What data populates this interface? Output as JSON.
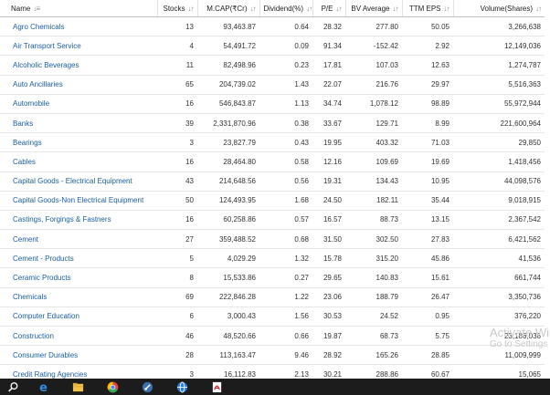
{
  "table": {
    "headers": {
      "name": "Name",
      "stocks": "Stocks",
      "mcap": "M.CAP(₹Cr)",
      "dividend": "Dividend(%)",
      "pe": "P/E",
      "bv": "BV Average",
      "eps": "TTM EPS",
      "volume": "Volume(Shares)"
    },
    "sort_glyph_name": "↓≡",
    "sort_glyph": "↓↑",
    "rows": [
      {
        "name": "Agro Chemicals",
        "stocks": "13",
        "mcap": "93,463.87",
        "dividend": "0.64",
        "pe": "28.32",
        "bv": "277.80",
        "eps": "50.05",
        "volume": "3,266,638"
      },
      {
        "name": "Air Transport Service",
        "stocks": "4",
        "mcap": "54,491.72",
        "dividend": "0.09",
        "pe": "91.34",
        "bv": "-152.42",
        "eps": "2.92",
        "volume": "12,149,036"
      },
      {
        "name": "Alcoholic Beverages",
        "stocks": "11",
        "mcap": "82,498.96",
        "dividend": "0.23",
        "pe": "17.81",
        "bv": "107.03",
        "eps": "12.63",
        "volume": "1,274,787"
      },
      {
        "name": "Auto Ancillaries",
        "stocks": "65",
        "mcap": "204,739.02",
        "dividend": "1.43",
        "pe": "22.07",
        "bv": "216.76",
        "eps": "29.97",
        "volume": "5,516,363"
      },
      {
        "name": "Automobile",
        "stocks": "16",
        "mcap": "546,843.87",
        "dividend": "1.13",
        "pe": "34.74",
        "bv": "1,078.12",
        "eps": "98.89",
        "volume": "55,972,944"
      },
      {
        "name": "Banks",
        "stocks": "39",
        "mcap": "2,331,870.96",
        "dividend": "0.38",
        "pe": "33.67",
        "bv": "129.71",
        "eps": "8.99",
        "volume": "221,600,964"
      },
      {
        "name": "Bearings",
        "stocks": "3",
        "mcap": "23,827.79",
        "dividend": "0.43",
        "pe": "19.95",
        "bv": "403.32",
        "eps": "71.03",
        "volume": "29,850"
      },
      {
        "name": "Cables",
        "stocks": "16",
        "mcap": "28,464.80",
        "dividend": "0.58",
        "pe": "12.16",
        "bv": "109.69",
        "eps": "19.69",
        "volume": "1,418,456"
      },
      {
        "name": "Capital Goods - Electrical Equipment",
        "stocks": "43",
        "mcap": "214,648.56",
        "dividend": "0.56",
        "pe": "19.31",
        "bv": "134.43",
        "eps": "10.95",
        "volume": "44,098,576"
      },
      {
        "name": "Capital Goods-Non Electrical Equipment",
        "stocks": "50",
        "mcap": "124,493.95",
        "dividend": "1.68",
        "pe": "24.50",
        "bv": "182.11",
        "eps": "35.44",
        "volume": "9,018,915"
      },
      {
        "name": "Castings, Forgings & Fastners",
        "stocks": "16",
        "mcap": "60,258.86",
        "dividend": "0.57",
        "pe": "16.57",
        "bv": "88.73",
        "eps": "13.15",
        "volume": "2,367,542"
      },
      {
        "name": "Cement",
        "stocks": "27",
        "mcap": "359,488.52",
        "dividend": "0.68",
        "pe": "31.50",
        "bv": "302.50",
        "eps": "27.83",
        "volume": "6,421,562"
      },
      {
        "name": "Cement - Products",
        "stocks": "5",
        "mcap": "4,029.29",
        "dividend": "1.32",
        "pe": "15.78",
        "bv": "315.20",
        "eps": "45.86",
        "volume": "41,536"
      },
      {
        "name": "Ceramic Products",
        "stocks": "8",
        "mcap": "15,533.86",
        "dividend": "0.27",
        "pe": "29.65",
        "bv": "140.83",
        "eps": "15.61",
        "volume": "661,744"
      },
      {
        "name": "Chemicals",
        "stocks": "69",
        "mcap": "222,846.28",
        "dividend": "1.22",
        "pe": "23.06",
        "bv": "188.79",
        "eps": "26.47",
        "volume": "3,350,736"
      },
      {
        "name": "Computer Education",
        "stocks": "6",
        "mcap": "3,000.43",
        "dividend": "1.56",
        "pe": "30.53",
        "bv": "24.52",
        "eps": "0.95",
        "volume": "376,220"
      },
      {
        "name": "Construction",
        "stocks": "46",
        "mcap": "48,520.66",
        "dividend": "0.66",
        "pe": "19.87",
        "bv": "68.73",
        "eps": "5.75",
        "volume": "23,186,036"
      },
      {
        "name": "Consumer Durables",
        "stocks": "28",
        "mcap": "113,163.47",
        "dividend": "9.46",
        "pe": "28.92",
        "bv": "165.26",
        "eps": "28.85",
        "volume": "11,009,999"
      },
      {
        "name": "Credit Rating Agencies",
        "stocks": "3",
        "mcap": "16,112.83",
        "dividend": "2.13",
        "pe": "30.21",
        "bv": "288.86",
        "eps": "60.67",
        "volume": "15,065"
      }
    ]
  },
  "watermark": {
    "line1": "Activate Windows",
    "line2": "Go to Settings to activate Windows."
  },
  "taskbar": {
    "icons": [
      "search-icon",
      "edge-icon",
      "file-explorer-icon",
      "chrome-icon",
      "fiddler-icon",
      "browser-icon",
      "pdf-icon"
    ],
    "colors": {
      "background": "#1c1c1c",
      "accent": "#1a5fa8"
    }
  }
}
